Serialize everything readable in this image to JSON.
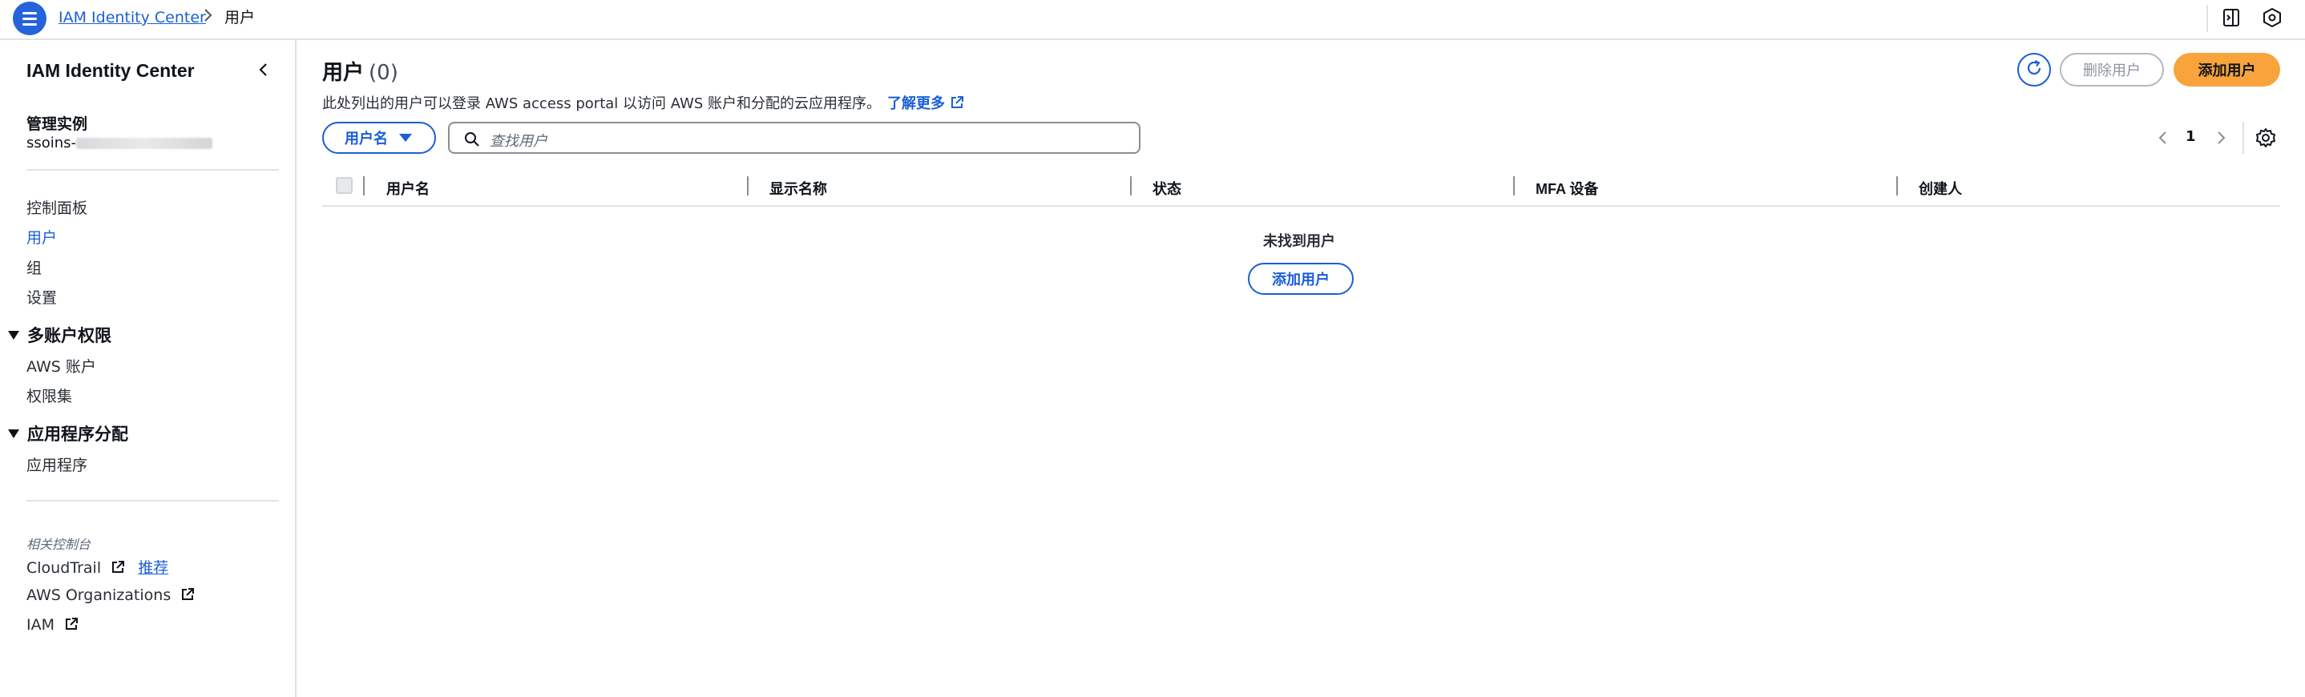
{
  "breadcrumb": {
    "root": "IAM Identity Center",
    "current": "用户"
  },
  "sidebar": {
    "title": "IAM Identity Center",
    "instance_label": "管理实例",
    "instance_value_prefix": "ssoins-",
    "nav": [
      {
        "label": "控制面板",
        "active": false
      },
      {
        "label": "用户",
        "active": true
      },
      {
        "label": "组",
        "active": false
      },
      {
        "label": "设置",
        "active": false
      }
    ],
    "sections": [
      {
        "title": "多账户权限",
        "items": [
          "AWS 账户",
          "权限集"
        ]
      },
      {
        "title": "应用程序分配",
        "items": [
          "应用程序"
        ]
      }
    ],
    "related_label": "相关控制台",
    "related": [
      {
        "label": "CloudTrail",
        "badge": "推荐"
      },
      {
        "label": "AWS Organizations",
        "badge": ""
      },
      {
        "label": "IAM",
        "badge": ""
      }
    ]
  },
  "main": {
    "title": "用户",
    "count": "(0)",
    "description": "此处列出的用户可以登录 AWS access portal 以访问 AWS 账户和分配的云应用程序。",
    "learn_more": "了解更多",
    "buttons": {
      "delete": "删除用户",
      "add": "添加用户"
    },
    "filter": {
      "property": "用户名",
      "placeholder": "查找用户"
    },
    "pagination": {
      "page": "1"
    },
    "table": {
      "columns": [
        "用户名",
        "显示名称",
        "状态",
        "MFA 设备",
        "创建人"
      ],
      "empty_text": "未找到用户",
      "empty_button": "添加用户"
    }
  },
  "colors": {
    "accent": "#1a5fd6",
    "primary_button": "#f8a33b",
    "border": "#e2e2e4"
  },
  "icons": [
    "menu-icon",
    "chevron-right-icon",
    "notification-panel-icon",
    "settings-hex-icon",
    "chevron-left-icon",
    "external-link-icon",
    "refresh-icon",
    "search-icon",
    "caret-down-icon",
    "gear-icon"
  ]
}
